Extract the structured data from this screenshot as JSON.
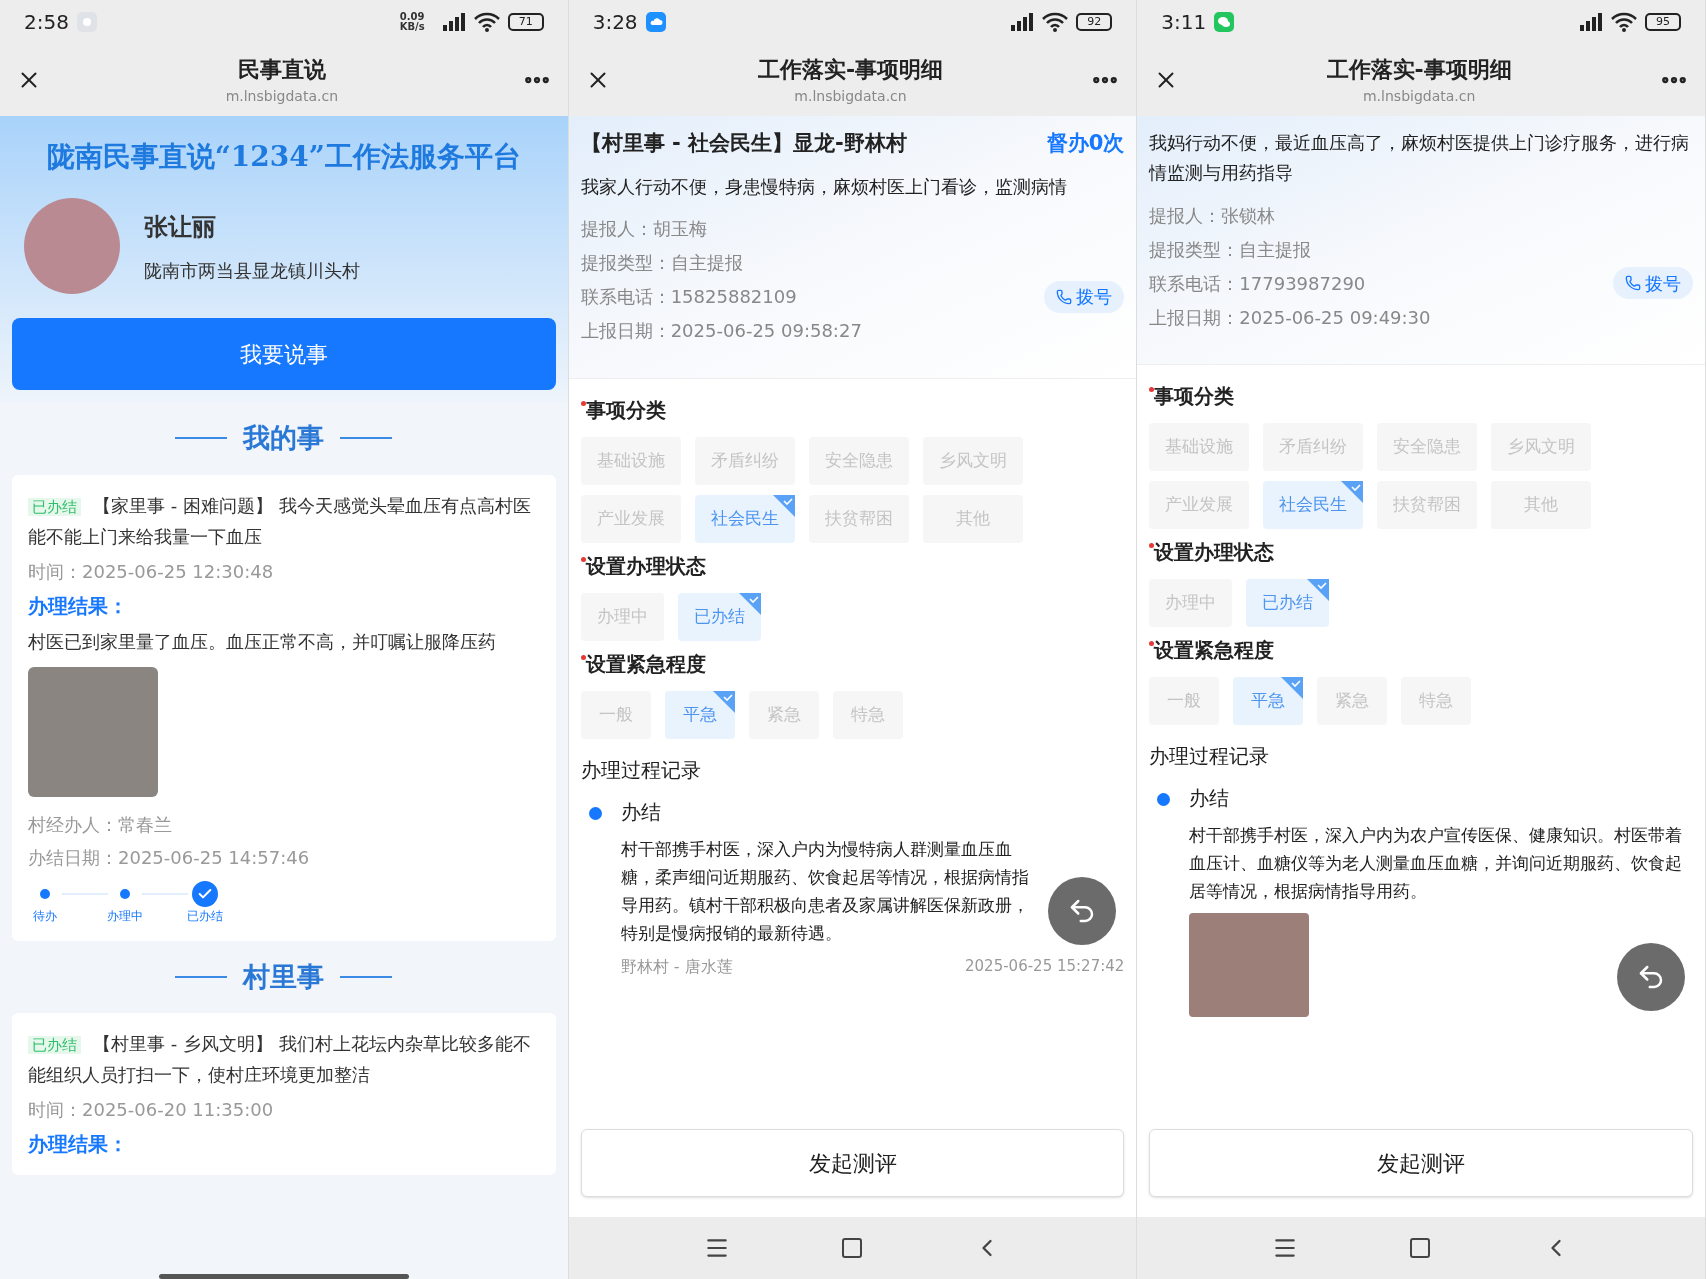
{
  "phones": [
    {
      "kind": "home",
      "status_bar": {
        "time": "2:58",
        "notification": {
          "kind": "record"
        },
        "net_speed": "0.09 KB/s",
        "battery": "71"
      },
      "header": {
        "title": "民事直说",
        "url": "m.lnsbigdata.cn"
      },
      "banner": {
        "title": "陇南民事直说“1234”工作法服务平台"
      },
      "profile": {
        "name": "张让丽",
        "address": "陇南市两当县显龙镇川头村"
      },
      "primary_button": "我要说事",
      "sections": [
        {
          "heading": "我的事",
          "cards": [
            {
              "status": "已办结",
              "text": "【家里事 - 困难问题】 我今天感觉头晕血压有点高村医能不能上门来给我量一下血压",
              "time": "时间：2025-06-25 12:30:48",
              "result_label": "办理结果：",
              "result": "村医已到家里量了血压。血压正常不高，并叮嘱让服降压药",
              "photo": true,
              "handler": "村经办人：常春兰",
              "done_date": "办结日期：2025-06-25 14:57:46",
              "steps": [
                {
                  "label": "待办",
                  "selected": false
                },
                {
                  "label": "办理中",
                  "selected": false
                },
                {
                  "label": "已办结",
                  "selected": true
                }
              ]
            }
          ]
        },
        {
          "heading": "村里事",
          "cards": [
            {
              "status": "已办结",
              "text": "【村里事 - 乡风文明】 我们村上花坛内杂草比较多能不能组织人员打扫一下，使村庄环境更加整洁",
              "time": "时间：2025-06-20 11:35:00",
              "result_label": "办理结果：",
              "photo": false
            }
          ]
        }
      ]
    },
    {
      "kind": "detail",
      "status_bar": {
        "time": "3:28",
        "notification": {
          "kind": "cloud"
        },
        "battery": "92"
      },
      "header": {
        "title": "工作落实-事项明细",
        "url": "m.lnsbigdata.cn"
      },
      "item": {
        "heading": "【村里事 - 社会民生】显龙-野林村",
        "supervise": "督办0次",
        "description": "我家人行动不便，身患慢特病，麻烦村医上门看诊，监测病情",
        "fields": [
          {
            "label": "提报人：",
            "value": "胡玉梅"
          },
          {
            "label": "提报类型：",
            "value": "自主提报"
          },
          {
            "label": "联系电话：",
            "value": "15825882109",
            "action": "拨号"
          },
          {
            "label": "上报日期：",
            "value": "2025-06-25 09:58:27"
          }
        ]
      },
      "option_groups": [
        {
          "label": "事项分类",
          "required": true,
          "options": [
            {
              "label": "基础设施",
              "selected": false
            },
            {
              "label": "矛盾纠纷",
              "selected": false
            },
            {
              "label": "安全隐患",
              "selected": false
            },
            {
              "label": "乡风文明",
              "selected": false
            },
            {
              "label": "产业发展",
              "selected": false
            },
            {
              "label": "社会民生",
              "selected": true
            },
            {
              "label": "扶贫帮困",
              "selected": false
            },
            {
              "label": "其他",
              "selected": false
            }
          ]
        },
        {
          "label": "设置办理状态",
          "required": true,
          "options": [
            {
              "label": "办理中",
              "selected": false
            },
            {
              "label": "已办结",
              "selected": true
            }
          ]
        },
        {
          "label": "设置紧急程度",
          "required": true,
          "options": [
            {
              "label": "一般",
              "selected": false
            },
            {
              "label": "平急",
              "selected": true
            },
            {
              "label": "紧急",
              "selected": false
            },
            {
              "label": "特急",
              "selected": false
            }
          ]
        }
      ],
      "record": {
        "title": "办理过程记录",
        "entries": [
          {
            "status": "办结",
            "text": "村干部携手村医，深入户内为慢特病人群测量血压血糖，柔声细问近期服药、饮食起居等情况，根据病情指导用药。镇村干部积极向患者及家属讲解医保新政册，特别是慢病报销的最新待遇。",
            "place": "野林村 - 唐水莲",
            "time": "2025-06-25 15:27:42",
            "photo": false
          }
        ]
      },
      "action_button": "发起测评"
    },
    {
      "kind": "detail",
      "status_bar": {
        "time": "3:11",
        "notification": {
          "kind": "chat"
        },
        "battery": "95"
      },
      "header": {
        "title": "工作落实-事项明细",
        "url": "m.lnsbigdata.cn"
      },
      "item": {
        "description": "我妈行动不便，最近血压高了，麻烦村医提供上门诊疗服务，进行病情监测与用药指导",
        "fields": [
          {
            "label": "提报人：",
            "value": "张锁林"
          },
          {
            "label": "提报类型：",
            "value": "自主提报"
          },
          {
            "label": "联系电话：",
            "value": "17793987290",
            "action": "拨号"
          },
          {
            "label": "上报日期：",
            "value": "2025-06-25 09:49:30"
          }
        ]
      },
      "option_groups": [
        {
          "label": "事项分类",
          "required": true,
          "options": [
            {
              "label": "基础设施",
              "selected": false
            },
            {
              "label": "矛盾纠纷",
              "selected": false
            },
            {
              "label": "安全隐患",
              "selected": false
            },
            {
              "label": "乡风文明",
              "selected": false
            },
            {
              "label": "产业发展",
              "selected": false
            },
            {
              "label": "社会民生",
              "selected": true
            },
            {
              "label": "扶贫帮困",
              "selected": false
            },
            {
              "label": "其他",
              "selected": false
            }
          ]
        },
        {
          "label": "设置办理状态",
          "required": true,
          "options": [
            {
              "label": "办理中",
              "selected": false
            },
            {
              "label": "已办结",
              "selected": true
            }
          ]
        },
        {
          "label": "设置紧急程度",
          "required": true,
          "options": [
            {
              "label": "一般",
              "selected": false
            },
            {
              "label": "平急",
              "selected": true
            },
            {
              "label": "紧急",
              "selected": false
            },
            {
              "label": "特急",
              "selected": false
            }
          ]
        }
      ],
      "record": {
        "title": "办理过程记录",
        "entries": [
          {
            "status": "办结",
            "text": "村干部携手村医，深入户内为农户宣传医保、健康知识。村医带着血压计、血糖仪等为老人测量血压血糖，并询问近期服药、饮食起居等情况，根据病情指导用药。",
            "photo": true
          }
        ]
      },
      "action_button": "发起测评"
    }
  ]
}
